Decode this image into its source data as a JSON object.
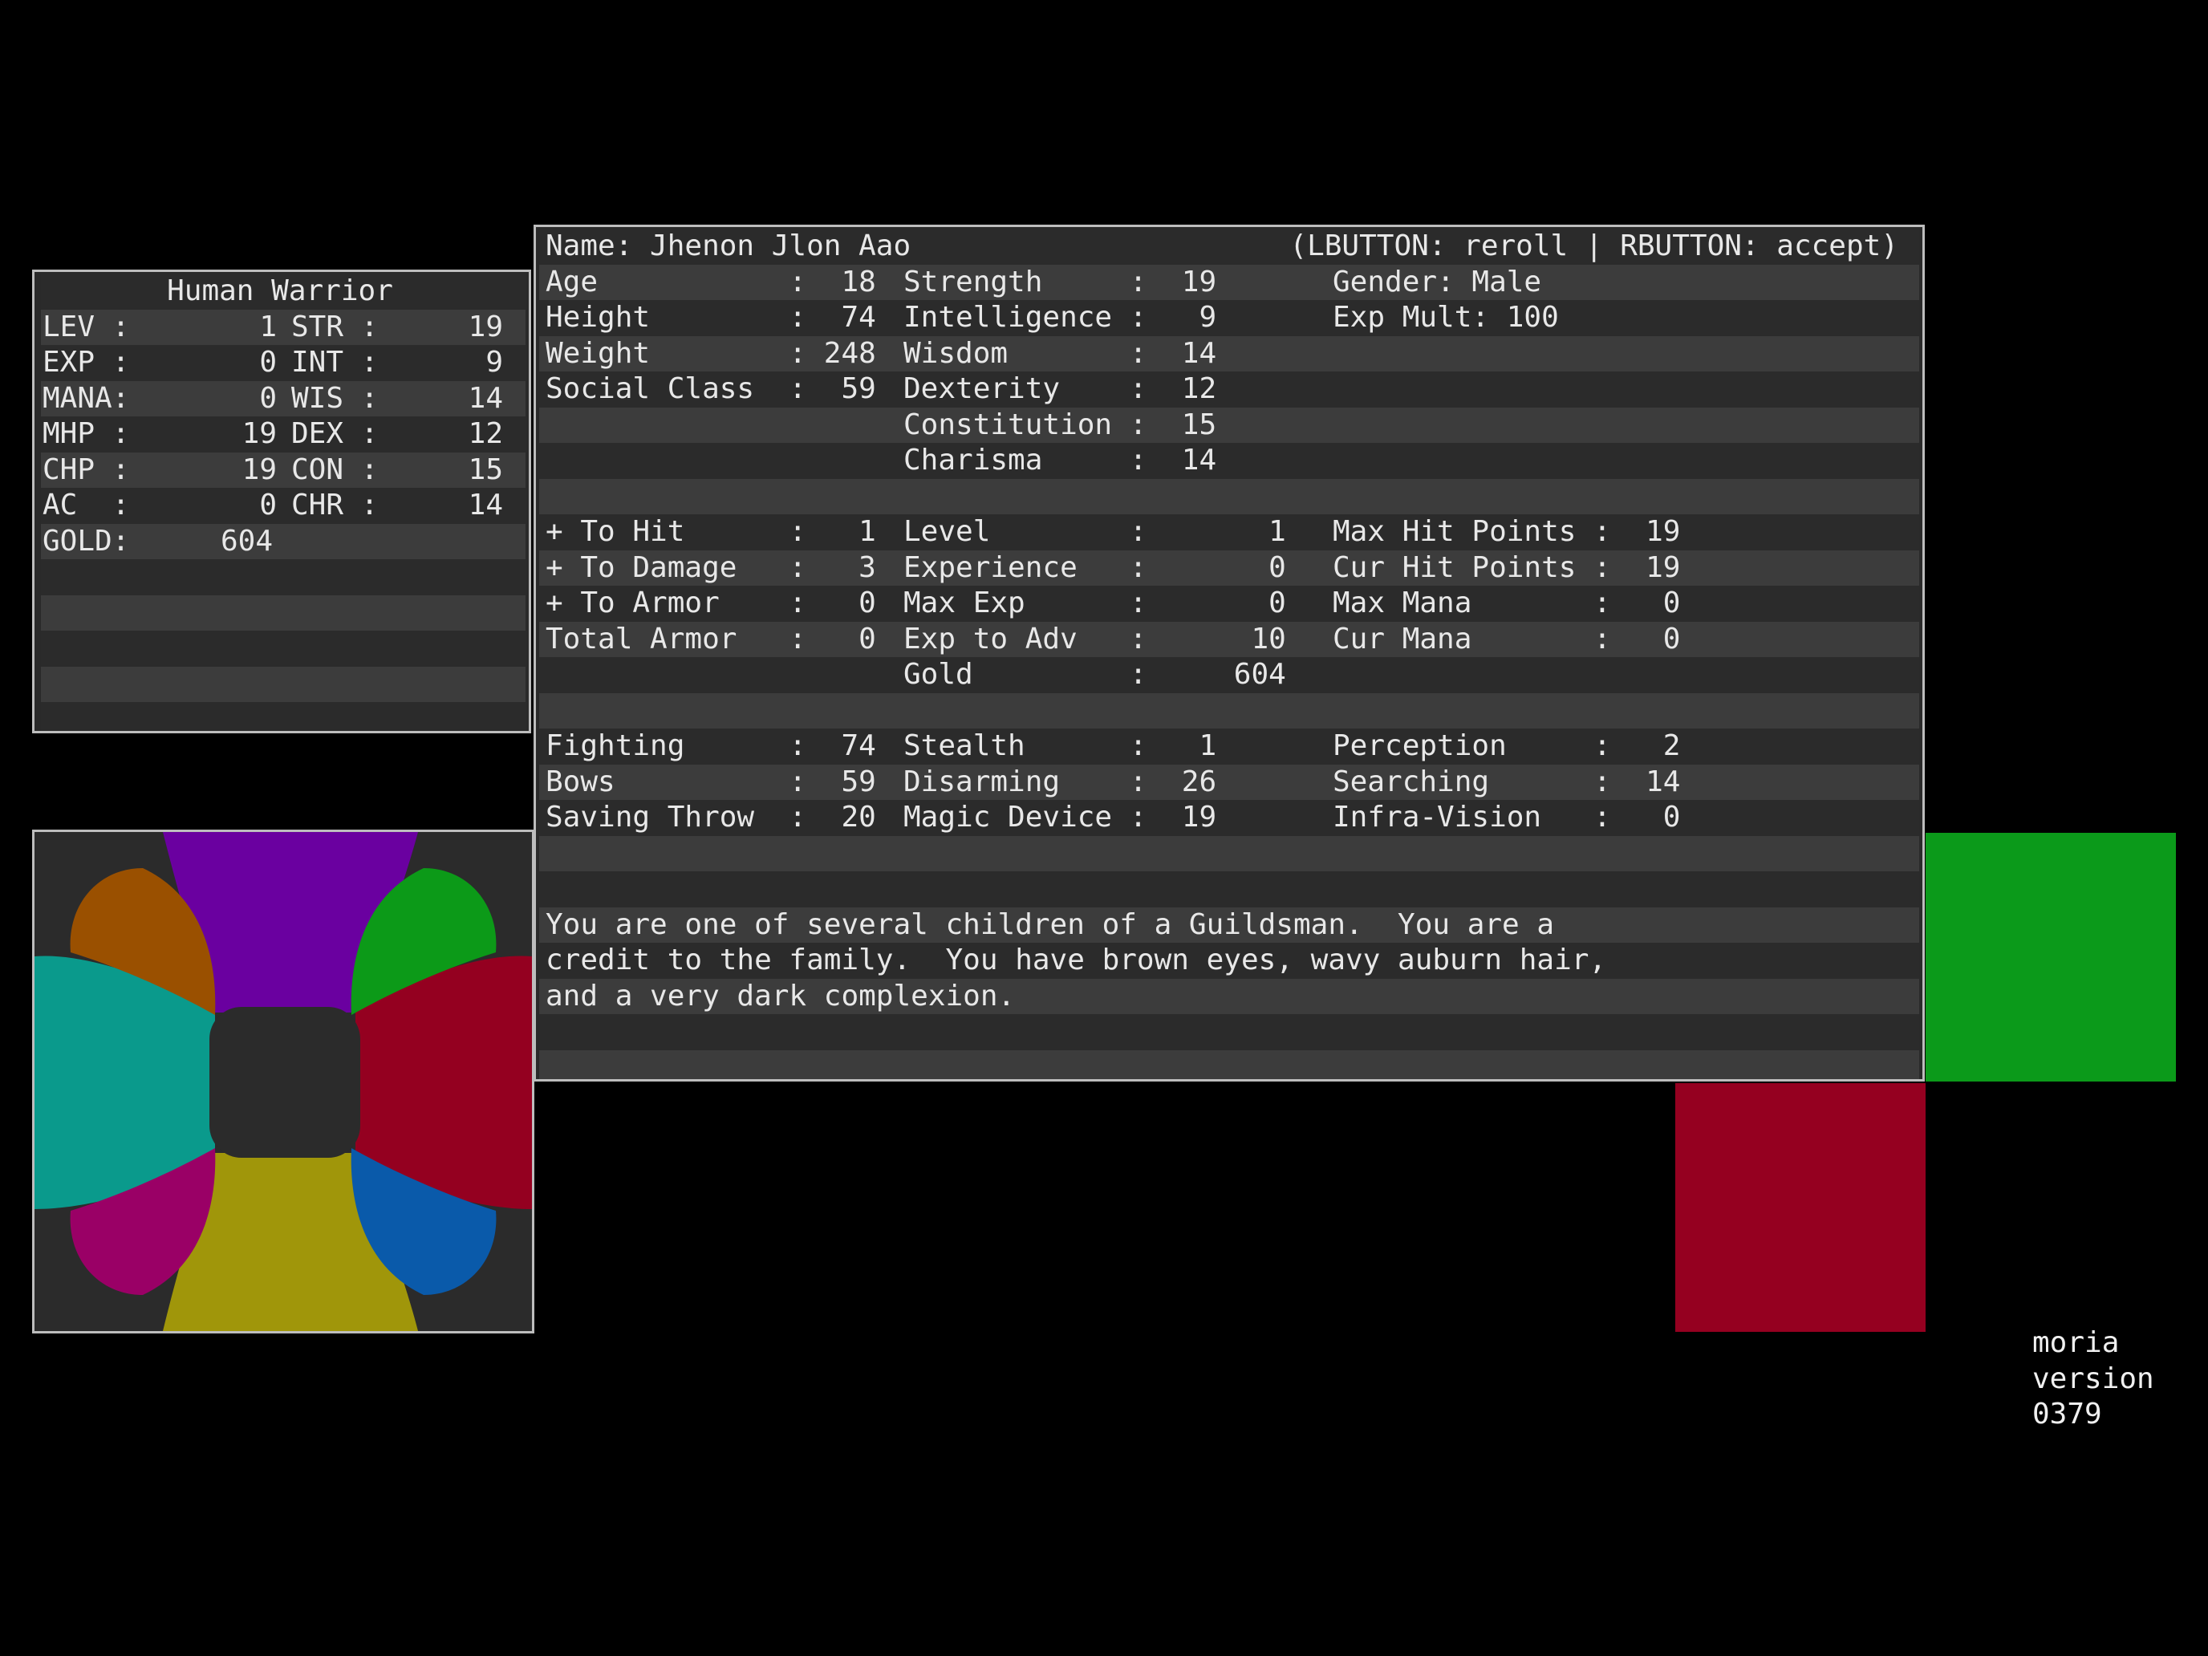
{
  "colors": {
    "background": "#000000",
    "panel_dark": "#2b2b2b",
    "panel_light": "#3c3c3c",
    "text": "#e8e8e8",
    "green_block": "#0b9a1a",
    "red_block": "#950020"
  },
  "summary": {
    "title": "Human Warrior",
    "rows": [
      {
        "l": "LEV :",
        "lv": "1",
        "r": "STR :",
        "rv": "19"
      },
      {
        "l": "EXP :",
        "lv": "0",
        "r": "INT :",
        "rv": "9"
      },
      {
        "l": "MANA:",
        "lv": "0",
        "r": "WIS :",
        "rv": "14"
      },
      {
        "l": "MHP :",
        "lv": "19",
        "r": "DEX :",
        "rv": "12"
      },
      {
        "l": "CHP :",
        "lv": "19",
        "r": "CON :",
        "rv": "15"
      },
      {
        "l": "AC  :",
        "lv": "0",
        "r": "CHR :",
        "rv": "14"
      }
    ],
    "gold_label": "GOLD:",
    "gold_value": "604"
  },
  "character": {
    "name_line": "Name: Jhenon Jlon Aao",
    "controls_hint": "(LBUTTON: reroll | RBUTTON: accept)",
    "rows": [
      [
        "Age           :  18",
        "Strength     :  19",
        "Gender: Male"
      ],
      [
        "Height        :  74",
        "Intelligence :   9",
        "Exp Mult: 100"
      ],
      [
        "Weight        : 248",
        "Wisdom       :  14",
        ""
      ],
      [
        "Social Class  :  59",
        "Dexterity    :  12",
        ""
      ],
      [
        "",
        "Constitution :  15",
        ""
      ],
      [
        "",
        "Charisma     :  14",
        ""
      ],
      [
        "",
        "",
        ""
      ],
      [
        "+ To Hit      :   1",
        "Level        :       1",
        "Max Hit Points :  19"
      ],
      [
        "+ To Damage   :   3",
        "Experience   :       0",
        "Cur Hit Points :  19"
      ],
      [
        "+ To Armor    :   0",
        "Max Exp      :       0",
        "Max Mana       :   0"
      ],
      [
        "Total Armor   :   0",
        "Exp to Adv   :      10",
        "Cur Mana       :   0"
      ],
      [
        "",
        "Gold         :     604",
        ""
      ],
      [
        "",
        "",
        ""
      ],
      [
        "Fighting      :  74",
        "Stealth      :   1",
        "Perception     :   2"
      ],
      [
        "Bows          :  59",
        "Disarming    :  26",
        "Searching      :  14"
      ],
      [
        "Saving Throw  :  20",
        "Magic Device :  19",
        "Infra-Vision   :   0"
      ],
      [
        "",
        "",
        ""
      ],
      [
        "",
        "",
        ""
      ],
      [
        "You are one of several children of a Guildsman.  You are a",
        "",
        ""
      ],
      [
        "credit to the family.  You have brown eyes, wavy auburn hair,",
        "",
        ""
      ],
      [
        "and a very dark complexion.",
        "",
        ""
      ],
      [
        "",
        "",
        ""
      ],
      [
        "",
        "",
        ""
      ]
    ]
  },
  "wheel": {
    "segments": [
      {
        "name": "top",
        "color": "#6a00a0"
      },
      {
        "name": "top-left",
        "color": "#9a5000"
      },
      {
        "name": "top-right",
        "color": "#0c9a18"
      },
      {
        "name": "left",
        "color": "#0a9a8c"
      },
      {
        "name": "right",
        "color": "#940020"
      },
      {
        "name": "bottom-left",
        "color": "#9a0066"
      },
      {
        "name": "bottom",
        "color": "#a0960a"
      },
      {
        "name": "bottom-right",
        "color": "#0a5aaa"
      }
    ]
  },
  "version": {
    "lines": [
      "moria",
      "version",
      "0379"
    ]
  }
}
